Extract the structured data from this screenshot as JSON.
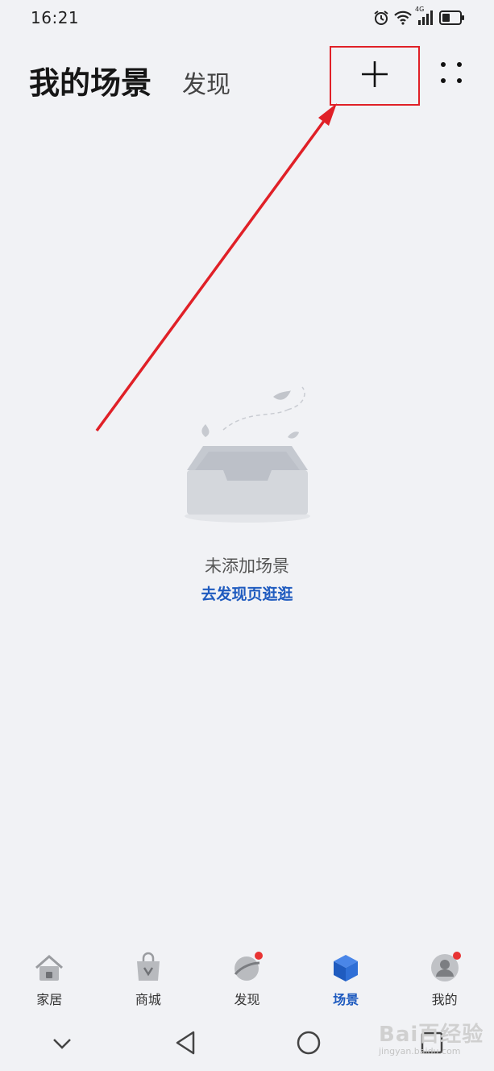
{
  "status_bar": {
    "time": "16:21",
    "network_label": "4G",
    "icons": [
      "alarm-icon",
      "wifi-icon",
      "signal-icon",
      "battery-icon"
    ]
  },
  "header": {
    "title": "我的场景",
    "discover_tab": "发现",
    "add_icon": "plus-icon",
    "more_icon": "more-dots-icon"
  },
  "empty_state": {
    "message": "未添加场景",
    "link": "去发现页逛逛"
  },
  "tabbar": {
    "items": [
      {
        "label": "家居",
        "icon": "home-icon",
        "active": false,
        "badge": false
      },
      {
        "label": "商城",
        "icon": "shopping-bag-icon",
        "active": false,
        "badge": false
      },
      {
        "label": "发现",
        "icon": "planet-icon",
        "active": false,
        "badge": true
      },
      {
        "label": "场景",
        "icon": "cube-icon",
        "active": true,
        "badge": false
      },
      {
        "label": "我的",
        "icon": "user-icon",
        "active": false,
        "badge": true
      }
    ]
  },
  "navbar": {
    "icons": [
      "chevron-down-icon",
      "back-triangle-icon",
      "home-circle-icon",
      "recent-square-icon"
    ]
  },
  "watermark": {
    "brand": "Bai百经验",
    "url": "jingyan.baidu.com"
  },
  "colors": {
    "background": "#f1f2f5",
    "accent": "#1f5bbf",
    "annotation": "#e02027",
    "badge": "#e83333"
  }
}
